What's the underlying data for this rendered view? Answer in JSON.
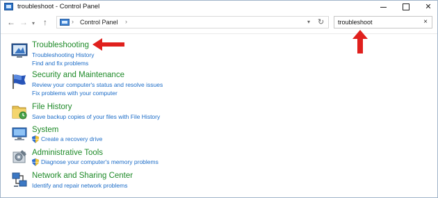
{
  "window": {
    "title": "troubleshoot - Control Panel",
    "minimize_icon": "minimize-icon",
    "maximize_icon": "maximize-icon",
    "close_icon": "close-icon",
    "close_glyph": "✕"
  },
  "nav": {
    "back_glyph": "←",
    "forward_glyph": "→",
    "recent_glyph": "▾",
    "up_glyph": "↑"
  },
  "address": {
    "separator": "›",
    "crumb": "Control Panel",
    "dropdown_glyph": "▾",
    "refresh_glyph": "↻"
  },
  "search": {
    "value": "troubleshoot",
    "clear_glyph": "×"
  },
  "results": [
    {
      "title": "Troubleshooting",
      "icon": "troubleshooting-icon",
      "links": [
        {
          "text": "Troubleshooting History",
          "shield": false
        },
        {
          "text": "Find and fix problems",
          "shield": false
        }
      ]
    },
    {
      "title": "Security and Maintenance",
      "icon": "security-flag-icon",
      "links": [
        {
          "text": "Review your computer's status and resolve issues",
          "shield": false
        },
        {
          "text": "Fix problems with your computer",
          "shield": false
        }
      ]
    },
    {
      "title": "File History",
      "icon": "file-history-icon",
      "links": [
        {
          "text": "Save backup copies of your files with File History",
          "shield": false
        }
      ]
    },
    {
      "title": "System",
      "icon": "system-computer-icon",
      "links": [
        {
          "text": "Create a recovery drive",
          "shield": true
        }
      ]
    },
    {
      "title": "Administrative Tools",
      "icon": "administrative-tools-icon",
      "links": [
        {
          "text": "Diagnose your computer's memory problems",
          "shield": true
        }
      ]
    },
    {
      "title": "Network and Sharing Center",
      "icon": "network-sharing-icon",
      "links": [
        {
          "text": "Identify and repair network problems",
          "shield": false
        }
      ]
    }
  ],
  "colors": {
    "title_green": "#1e8a28",
    "link_blue": "#1a6bc7",
    "annotation_red": "#e0201d"
  }
}
